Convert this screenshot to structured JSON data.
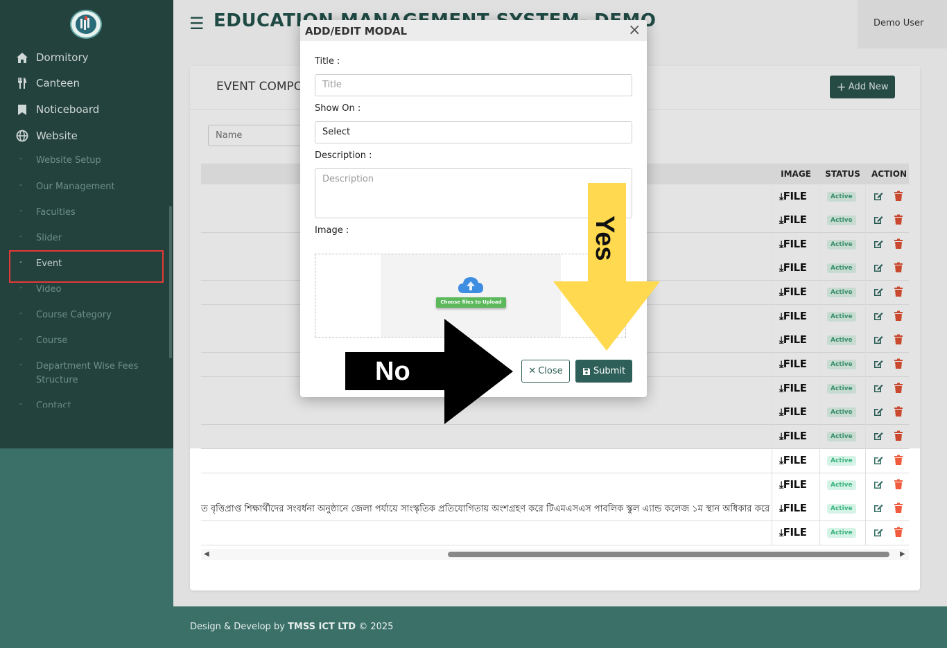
{
  "sidebar": {
    "items": [
      {
        "label": "Dormitory",
        "icon": "home-icon"
      },
      {
        "label": "Canteen",
        "icon": "utensils-icon"
      },
      {
        "label": "Noticeboard",
        "icon": "bookmark-icon"
      },
      {
        "label": "Website",
        "icon": "globe-icon"
      }
    ],
    "sub_items": [
      "Website Setup",
      "Our Management",
      "Faculties",
      "Slider",
      "Event",
      "Video",
      "Course Category",
      "Course",
      "Department Wise Fees Structure",
      "Contact"
    ],
    "dash": "-"
  },
  "header": {
    "title": "EDUCATION MANAGEMENT SYSTEM- DEMO",
    "user": "Demo User"
  },
  "card": {
    "title": "EVENT COMPONENT",
    "add_new": "Add New",
    "name_placeholder": "Name"
  },
  "table": {
    "columns": [
      "IMAGE",
      "STATUS",
      "ACTION"
    ],
    "file_label": "FILE",
    "status": "Active",
    "row_text": "ত বৃত্তিপ্রাপ্ত শিক্ষার্থীদের সংবর্ধনা অনুষ্ঠানে জেলা পর্যায়ে সাংস্কৃতিক প্রতিযোগিতায় অংশগ্রহণ করে টিএমএসএস পাবলিক স্কুল এ্যান্ড কলেজ ১ম স্থান অধিকার করে।"
  },
  "footer": {
    "prefix": "Design & Develop by ",
    "company": "TMSS ICT LTD",
    "suffix": " © 2025"
  },
  "modal": {
    "title": "ADD/EDIT MODAL",
    "close_x": "×",
    "title_label": "Title :",
    "title_placeholder": "Title",
    "show_on_label": "Show On :",
    "show_on_value": "Select",
    "description_label": "Description :",
    "description_placeholder": "Description",
    "image_label": "Image :",
    "upload_label": "Choose files to Upload",
    "close_button": "Close",
    "submit_button": "Submit"
  },
  "annotations": {
    "no": "No",
    "yes": "Yes"
  },
  "colors": {
    "sidebar": "#24423d",
    "accent": "#2e6059",
    "highlight": "#e53935",
    "yes_arrow": "#ffd94f",
    "no_arrow": "#000000"
  }
}
